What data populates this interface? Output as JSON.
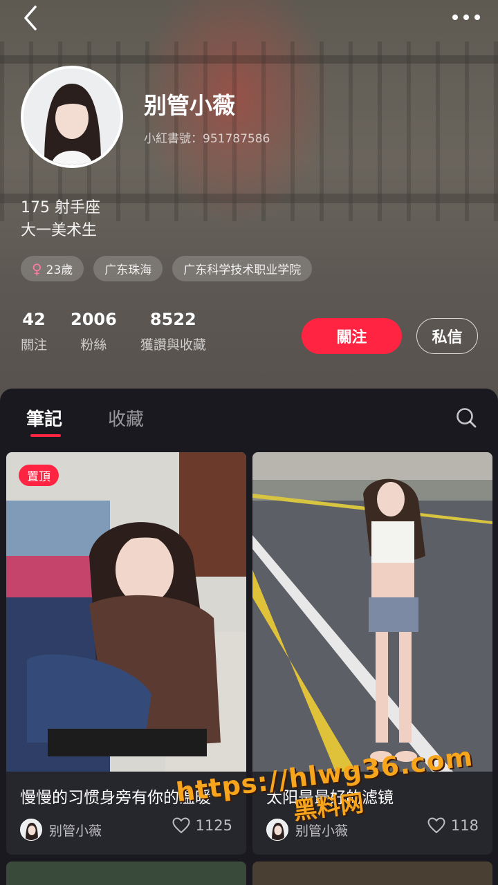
{
  "profile": {
    "username": "别管小薇",
    "user_id": "小紅書號：951787586",
    "bio_line1": "175 射手座",
    "bio_line2": "大一美术生",
    "tags": {
      "age": "23歲",
      "location": "广东珠海",
      "school": "广东科学技术职业学院"
    },
    "stats": {
      "following_count": "42",
      "following_label": "關注",
      "followers_count": "2006",
      "followers_label": "粉絲",
      "likes_count": "8522",
      "likes_label": "獲讚與收藏"
    },
    "follow_button": "關注",
    "message_button": "私信"
  },
  "tabs": {
    "notes": "筆記",
    "collections": "收藏"
  },
  "notes": [
    {
      "pinned_label": "置頂",
      "title": "慢慢的习惯身旁有你的温暖",
      "author": "别管小薇",
      "likes": "1125"
    },
    {
      "title": "太阳是最好的滤镜",
      "author": "别管小薇",
      "likes": "118"
    }
  ],
  "watermark": {
    "url": "https://hlwg36.com",
    "name": "黑料网"
  },
  "colors": {
    "accent": "#ff2442",
    "panel_bg": "#19191f",
    "card_bg": "#26262d",
    "watermark": "#f7a51c"
  },
  "icons": [
    "back-arrow-icon",
    "more-dots-icon",
    "female-icon",
    "search-icon",
    "heart-icon"
  ]
}
